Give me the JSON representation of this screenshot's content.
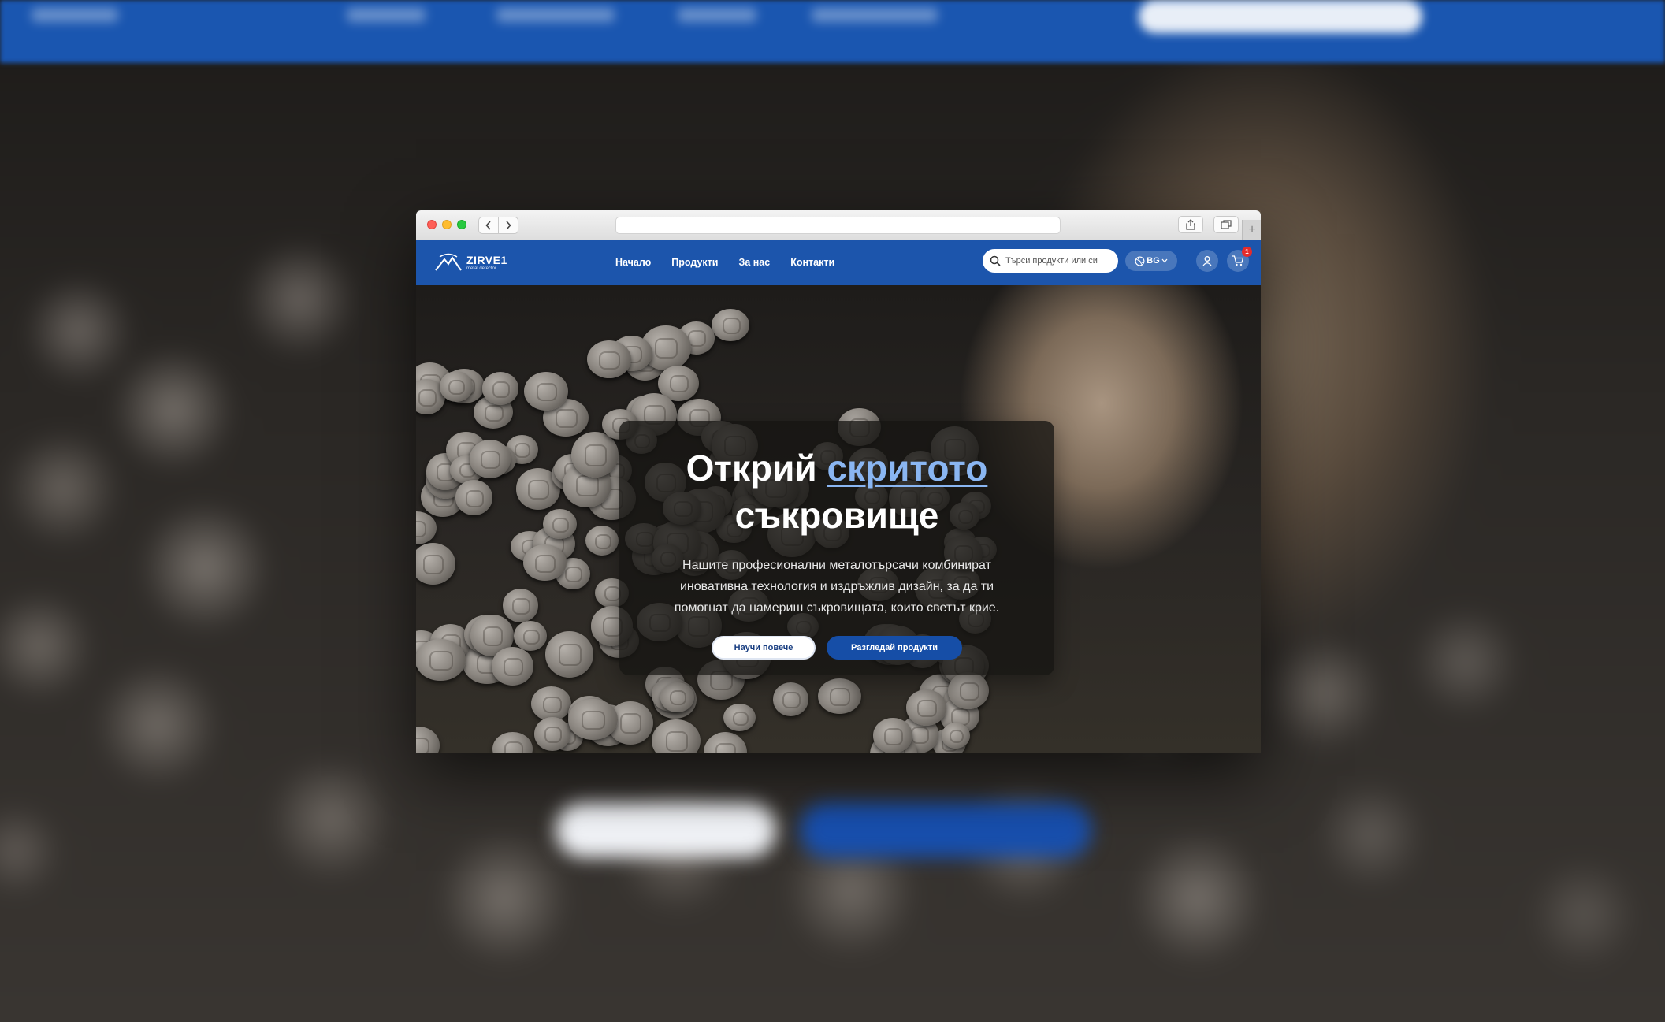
{
  "site": {
    "logo": {
      "name": "ZIRVE1",
      "tagline": "metal detector"
    },
    "nav": [
      {
        "label": "Начало"
      },
      {
        "label": "Продукти"
      },
      {
        "label": "За нас"
      },
      {
        "label": "Контакти"
      }
    ],
    "search": {
      "placeholder": "Търси продукти или си"
    },
    "language": "BG",
    "cart_count": "1"
  },
  "hero": {
    "title_part1": "Открий ",
    "title_accent": "скритото",
    "title_part2": "съкровище",
    "description": "Нашите професионални металотърсачи комбинират иновативна технология и издръжлив дизайн, за да ти помогнат да намериш съкровищата, които светът крие.",
    "primary_button": "Научи повече",
    "secondary_button": "Разгледай продукти"
  },
  "colors": {
    "brand_blue": "#1c55ac",
    "accent_link": "#8ab6f2",
    "badge_red": "#e52b2b"
  },
  "icons": [
    "share-icon",
    "tabs-icon",
    "search-icon",
    "globe-icon",
    "chevron-down-icon",
    "user-icon",
    "cart-icon",
    "mountain-logo-icon"
  ]
}
